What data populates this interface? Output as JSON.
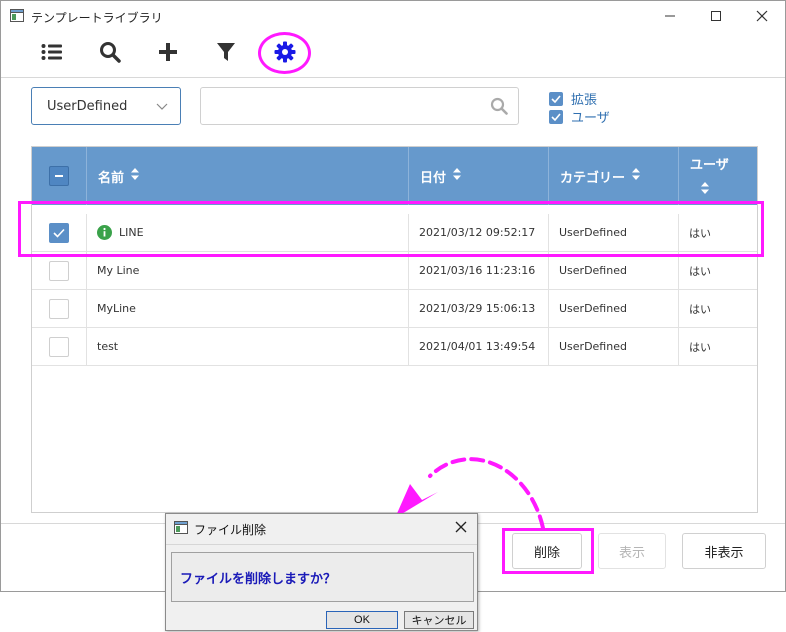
{
  "window": {
    "title": "テンプレートライブラリ"
  },
  "filter": {
    "type_value": "UserDefined",
    "search_value": "",
    "search_placeholder": "",
    "checkboxes": [
      {
        "label": "拡張",
        "checked": true
      },
      {
        "label": "ユーザ",
        "checked": true
      }
    ]
  },
  "table": {
    "columns": [
      "名前",
      "日付",
      "カテゴリー",
      "ユーザ"
    ],
    "rows": [
      {
        "name": "LINE",
        "date": "2021/03/12 09:52:17",
        "category": "UserDefined",
        "user": "はい",
        "checked": true,
        "info": true
      },
      {
        "name": "My Line",
        "date": "2021/03/16 11:23:16",
        "category": "UserDefined",
        "user": "はい",
        "checked": false,
        "info": false
      },
      {
        "name": "MyLine",
        "date": "2021/03/29 15:06:13",
        "category": "UserDefined",
        "user": "はい",
        "checked": false,
        "info": false
      },
      {
        "name": "test",
        "date": "2021/04/01 13:49:54",
        "category": "UserDefined",
        "user": "はい",
        "checked": false,
        "info": false
      }
    ]
  },
  "buttons": {
    "delete": "削除",
    "show": "表示",
    "hide": "非表示"
  },
  "dialog": {
    "title": "ファイル削除",
    "message": "ファイルを削除しますか？",
    "ok": "OK",
    "cancel": "キャンセル"
  },
  "colors": {
    "header_bg": "#6699cc",
    "accent": "#5b8fc7",
    "annotation": "#ff19ff",
    "settings_icon": "#1a1ae6"
  }
}
